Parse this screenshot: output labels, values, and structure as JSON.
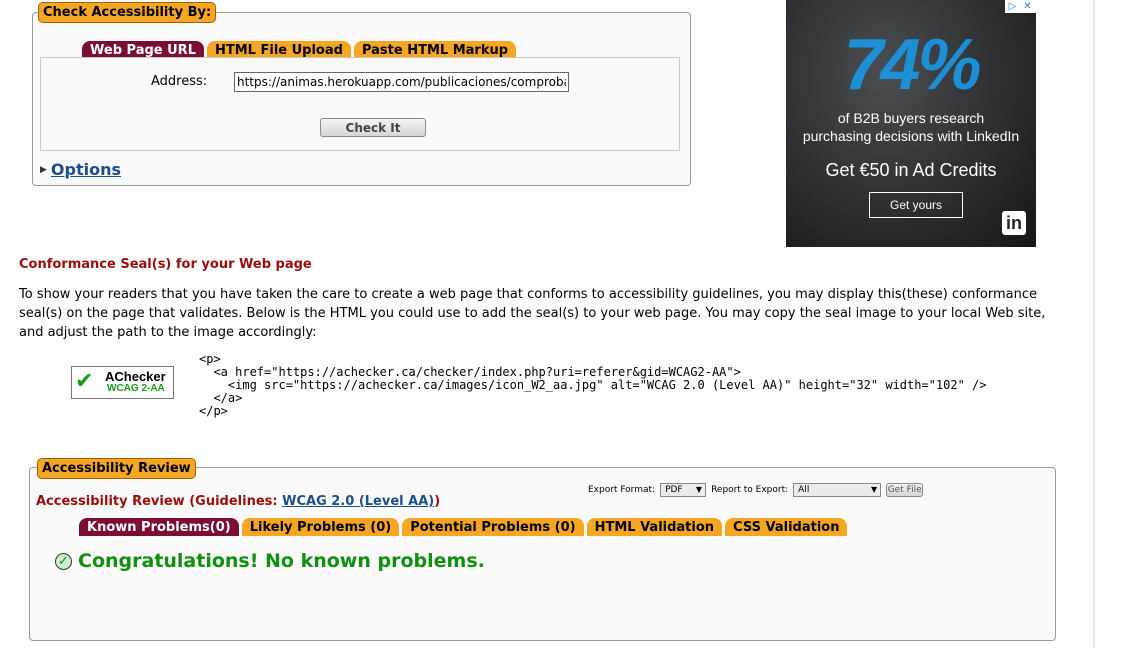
{
  "check_form": {
    "legend": "Check Accessibility By:",
    "tabs": [
      "Web Page URL",
      "HTML File Upload",
      "Paste HTML Markup"
    ],
    "address_label": "Address:",
    "address_value": "https://animas.herokuapp.com/publicaciones/comprobar?",
    "check_button": "Check It",
    "options_link": "Options"
  },
  "ad": {
    "headline": "74%",
    "line1": "of B2B buyers research",
    "line2": "purchasing decisions with LinkedIn",
    "credit": "Get €50 in Ad Credits",
    "button": "Get yours",
    "logo": "in",
    "adchoices_icon": "adchoices-icon",
    "close_icon": "close-icon"
  },
  "conformance": {
    "title": "Conformance Seal(s) for your Web page",
    "text": "To show your readers that you have taken the care to create a web page that conforms to accessibility guidelines, you may display this(these) conformance seal(s) on the page that validates. Below is the HTML you could use to add the seal(s) to your web page. You may copy the seal image to your local Web site, and adjust the path to the image accordingly:",
    "seal_title": "AChecker",
    "seal_sub": "WCAG 2-AA",
    "code": "<p>\n  <a href=\"https://achecker.ca/checker/index.php?uri=referer&gid=WCAG2-AA\">\n    <img src=\"https://achecker.ca/images/icon_W2_aa.jpg\" alt=\"WCAG 2.0 (Level AA)\" height=\"32\" width=\"102\" />\n  </a>\n</p>"
  },
  "review": {
    "legend": "Accessibility Review",
    "title_prefix": "Accessibility Review (Guidelines: ",
    "guideline_link": "WCAG 2.0 (Level AA)",
    "title_suffix": ")",
    "export_label": "Export Format:",
    "export_value": "PDF",
    "report_label": "Report to Export:",
    "report_value": "All",
    "get_file": "Get File",
    "tabs": [
      "Known Problems(0)",
      "Likely Problems (0)",
      "Potential Problems (0)",
      "HTML Validation",
      "CSS Validation"
    ],
    "congrats": "Congratulations! No known problems."
  },
  "colors": {
    "tab_orange": "#f5a623",
    "tab_active": "#7a0e37",
    "heading_red": "#9b0d0d",
    "link_blue": "#1b4f8a",
    "success_green": "#11900f"
  }
}
